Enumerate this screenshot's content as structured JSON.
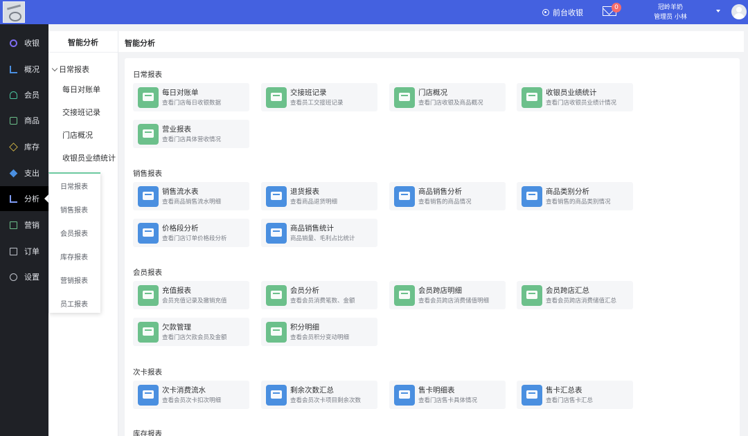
{
  "header": {
    "cashier_label": "前台收银",
    "mail_badge": "0",
    "store_name": "冠岭羊奶",
    "user_line": "管理员 小林"
  },
  "sidebar": {
    "items": [
      {
        "label": "收银",
        "icon": "cashier-icon"
      },
      {
        "label": "概况",
        "icon": "bar-chart-icon"
      },
      {
        "label": "会员",
        "icon": "member-icon"
      },
      {
        "label": "商品",
        "icon": "goods-icon"
      },
      {
        "label": "库存",
        "icon": "stock-icon"
      },
      {
        "label": "支出",
        "icon": "expense-icon"
      },
      {
        "label": "分析",
        "icon": "analysis-icon"
      },
      {
        "label": "营销",
        "icon": "marketing-gift-icon"
      },
      {
        "label": "订单",
        "icon": "order-icon"
      },
      {
        "label": "设置",
        "icon": "settings-gear-icon"
      }
    ],
    "active_index": 6
  },
  "subnav": {
    "title": "智能分析",
    "group": "日常报表",
    "items": [
      "每日对账单",
      "交接班记录",
      "门店概况",
      "收银员业绩统计"
    ],
    "popup": [
      "日常报表",
      "销售报表",
      "会员报表",
      "库存报表",
      "营销报表",
      "员工报表"
    ]
  },
  "main": {
    "header_title": "智能分析",
    "sections": [
      {
        "title": "日常报表",
        "cards": [
          {
            "title": "每日对账单",
            "desc": "查看门店每日收银数据",
            "color": "#6cc08b"
          },
          {
            "title": "交接班记录",
            "desc": "查看员工交接班记录",
            "color": "#6cc08b"
          },
          {
            "title": "门店概况",
            "desc": "查看门店收银及商品概况",
            "color": "#6cc08b"
          },
          {
            "title": "收银员业绩统计",
            "desc": "查看门店收银员业绩计情况",
            "color": "#6cc08b"
          },
          {
            "title": "营业报表",
            "desc": "查看门店具体营收情况",
            "color": "#6cc08b"
          }
        ]
      },
      {
        "title": "销售报表",
        "cards": [
          {
            "title": "销售流水表",
            "desc": "查看商品销售流水明细",
            "color": "#4a8fe0"
          },
          {
            "title": "退货报表",
            "desc": "查看商品退货明细",
            "color": "#4a8fe0"
          },
          {
            "title": "商品销售分析",
            "desc": "查看销售的商品情况",
            "color": "#4a8fe0"
          },
          {
            "title": "商品类别分析",
            "desc": "查看销售的商品类别情况",
            "color": "#4a8fe0"
          },
          {
            "title": "价格段分析",
            "desc": "查看门店订单价格段分析",
            "color": "#4a8fe0"
          },
          {
            "title": "商品销售统计",
            "desc": "商品销量、毛利占比统计",
            "color": "#4a8fe0"
          }
        ]
      },
      {
        "title": "会员报表",
        "cards": [
          {
            "title": "充值报表",
            "desc": "会员充值记录及撤销充值",
            "color": "#6cc08b"
          },
          {
            "title": "会员分析",
            "desc": "查看会员消费笔数、金额",
            "color": "#6cc08b"
          },
          {
            "title": "会员跨店明细",
            "desc": "查看会员跨店消费储值明细",
            "color": "#6cc08b"
          },
          {
            "title": "会员跨店汇总",
            "desc": "查看会员跨店消费储值汇总",
            "color": "#6cc08b"
          },
          {
            "title": "欠款管理",
            "desc": "查看门店欠款会员及金额",
            "color": "#6cc08b"
          },
          {
            "title": "积分明细",
            "desc": "查看会员积分变动明细",
            "color": "#6cc08b"
          }
        ]
      },
      {
        "title": "次卡报表",
        "cards": [
          {
            "title": "次卡消费流水",
            "desc": "查看会员次卡扣次明细",
            "color": "#4a8fe0"
          },
          {
            "title": "剩余次数汇总",
            "desc": "查看会员次卡项目剩余次数",
            "color": "#4a8fe0"
          },
          {
            "title": "售卡明细表",
            "desc": "查看门店售卡具体情况",
            "color": "#4a8fe0"
          },
          {
            "title": "售卡汇总表",
            "desc": "查看门店售卡汇总",
            "color": "#4a8fe0"
          }
        ]
      },
      {
        "title": "库存报表",
        "cards": []
      }
    ]
  }
}
